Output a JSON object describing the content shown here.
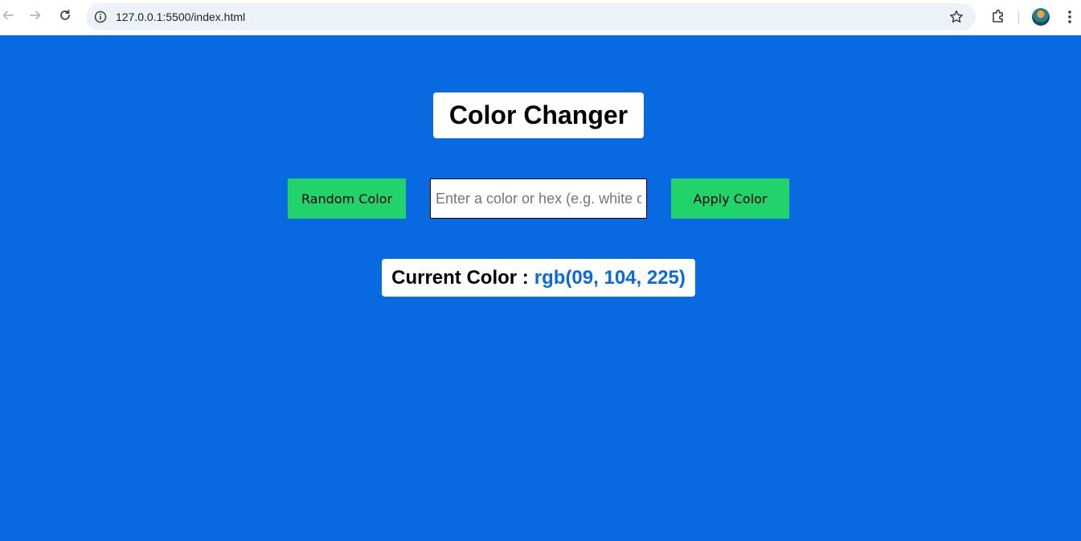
{
  "browser": {
    "url": "127.0.0.1:5500/index.html"
  },
  "page": {
    "background_color": "#0969e1",
    "title": "Color Changer",
    "random_button_label": "Random Color",
    "color_input": {
      "placeholder": "Enter a color or hex (e.g. white or #fff)",
      "value": ""
    },
    "apply_button_label": "Apply Color",
    "current_color_label": "Current Color :",
    "current_color_value": "rgb(09, 104, 225)",
    "button_color": "#22d36b"
  },
  "icons": {
    "back": "arrow-left-icon",
    "forward": "arrow-right-icon",
    "reload": "reload-icon",
    "site_info": "info-icon",
    "bookmark": "star-icon",
    "extensions": "puzzle-icon",
    "profile": "avatar",
    "menu": "kebab-menu-icon"
  }
}
